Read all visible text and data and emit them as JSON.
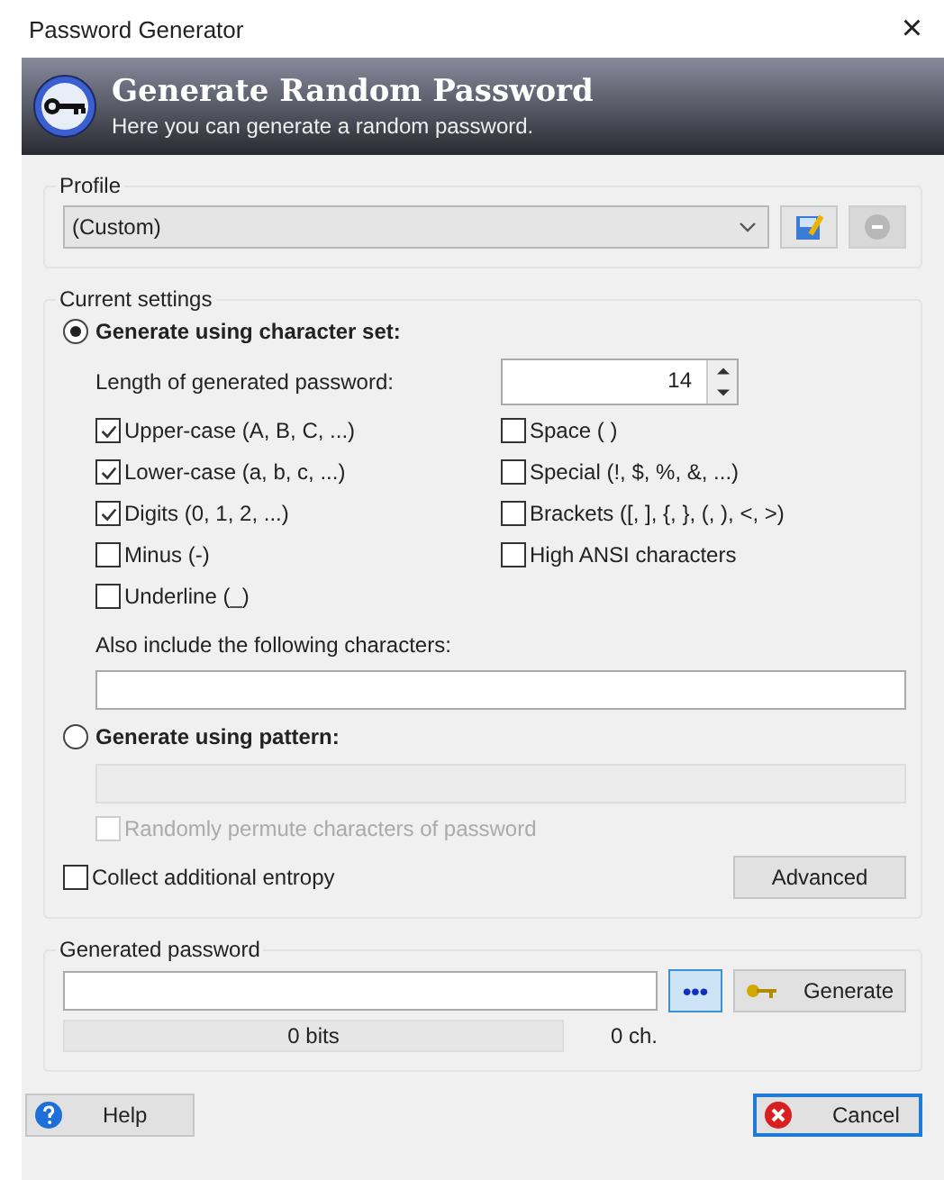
{
  "window": {
    "title": "Password Generator",
    "close": "×"
  },
  "banner": {
    "title": "Generate Random Password",
    "subtitle": "Here you can generate a random password."
  },
  "profile": {
    "label": "Profile",
    "value": "(Custom)",
    "save_disabled": false,
    "delete_disabled": true
  },
  "settings": {
    "label": "Current settings",
    "modes": [
      {
        "label": "Generate using character set:",
        "selected": true
      },
      {
        "label": "Generate using pattern:",
        "selected": false
      }
    ],
    "length_label": "Length of generated password:",
    "length": "14",
    "charsets_left": [
      {
        "label": "Upper-case (A, B, C, ...)",
        "checked": true
      },
      {
        "label": "Lower-case (a, b, c, ...)",
        "checked": true
      },
      {
        "label": "Digits (0, 1, 2, ...)",
        "checked": true
      },
      {
        "label": "Minus (-)",
        "checked": false
      },
      {
        "label": "Underline (_)",
        "checked": false
      }
    ],
    "charsets_right": [
      {
        "label": "Space ( )",
        "checked": false
      },
      {
        "label": "Special (!, $, %, &, ...)",
        "checked": false
      },
      {
        "label": "Brackets ([, ], {, }, (, ), <, >)",
        "checked": false
      },
      {
        "label": "High ANSI characters",
        "checked": false
      }
    ],
    "include_label": "Also include the following characters:",
    "pattern_disabled": true,
    "permute": {
      "label": "Randomly permute characters of password",
      "checked": false,
      "disabled": true
    },
    "entropy": {
      "label": "Collect additional entropy",
      "checked": false
    },
    "advanced": "Advanced"
  },
  "generated": {
    "label": "Generated password",
    "hide": "•••",
    "generate": "Generate",
    "bits": "0 bits",
    "chars": "0 ch."
  },
  "buttons": {
    "help": "Help",
    "cancel": "Cancel"
  }
}
